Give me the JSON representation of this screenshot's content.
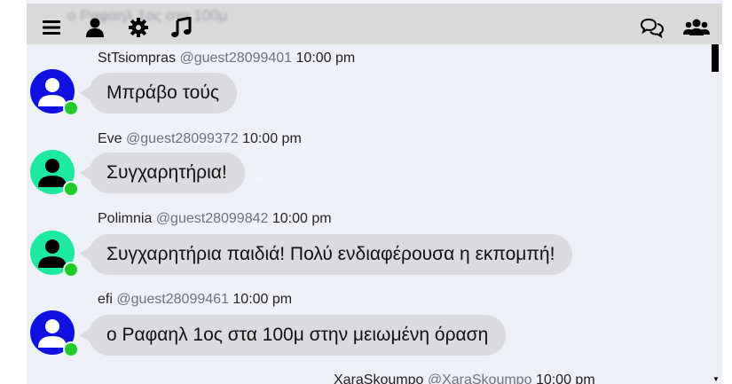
{
  "topbar": {
    "ghost_text": "ο Ραφαηλ 1ος στα 100μ",
    "icons": [
      "menu-icon",
      "user-icon",
      "gear-icon",
      "music-icon",
      "chat-icon",
      "users-icon"
    ]
  },
  "colors": {
    "panel_bg": "#eef1f7",
    "topbar_bg": "#d9d9d9",
    "bubble_bg": "#dadbdf",
    "online": "#1fcc2a",
    "avatar_blue": "#1010e0",
    "avatar_green": "#1de9a0"
  },
  "messages": [
    {
      "name": "StTsiompras",
      "handle": "@guest28099401",
      "time": "10:00 pm",
      "text": "Μπράβο τούς",
      "avatar": "blue"
    },
    {
      "name": "Eve",
      "handle": "@guest28099372",
      "time": "10:00 pm",
      "text": "Συγχαρητήρια!",
      "avatar": "green"
    },
    {
      "name": "Polimnia",
      "handle": "@guest28099842",
      "time": "10:00 pm",
      "text": "Συγχαρητήρια παιδιά! Πολύ ενδιαφέρουσα η εκπομπή!",
      "avatar": "green"
    },
    {
      "name": "efi",
      "handle": "@guest28099461",
      "time": "10:00 pm",
      "text": "ο Ραφαηλ 1ος στα 100μ στην μειωμένη όραση",
      "avatar": "blue"
    }
  ],
  "partial_message": {
    "name": "XaraSkoumpo",
    "handle": "@XaraSkoumpo",
    "time": "10:00 pm"
  },
  "typing_indicator": "···"
}
